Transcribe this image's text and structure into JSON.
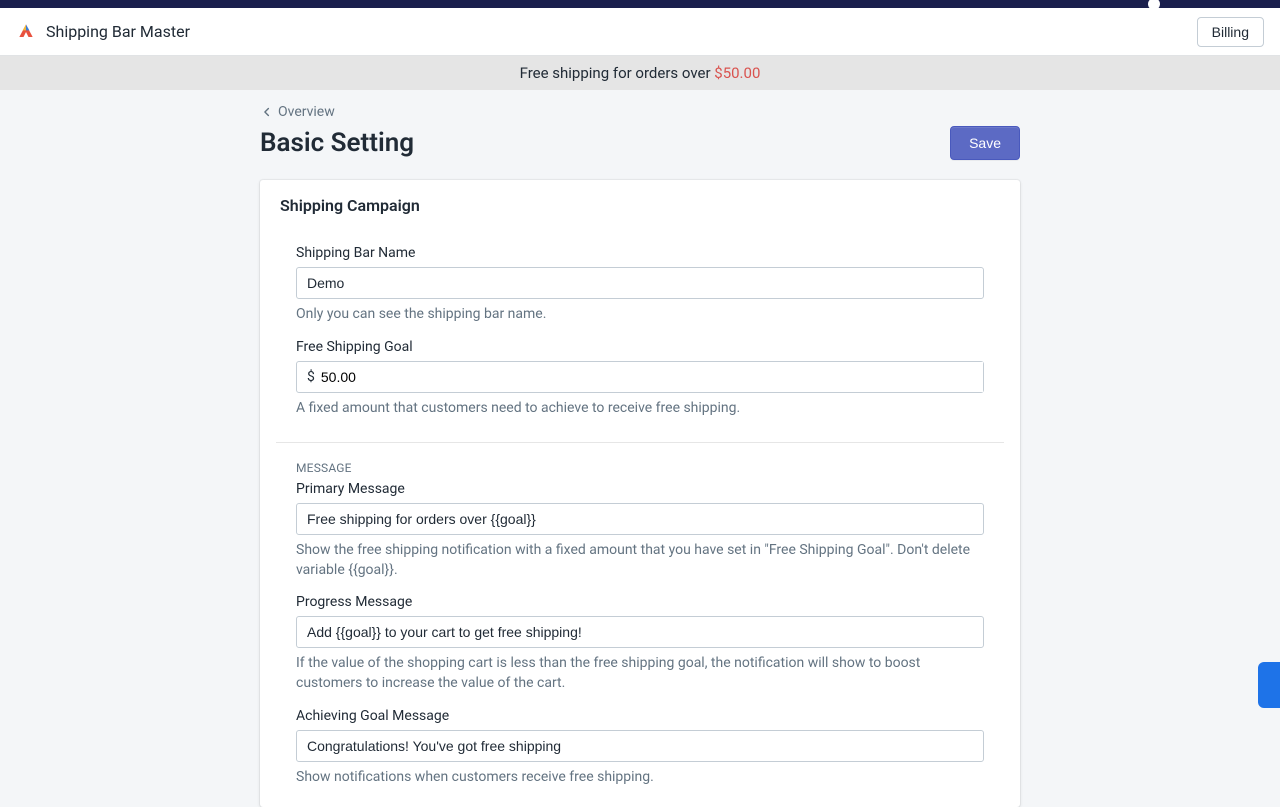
{
  "header": {
    "app_title": "Shipping Bar Master",
    "billing_label": "Billing"
  },
  "banner": {
    "text_prefix": "Free shipping for orders over ",
    "price": "$50.00"
  },
  "breadcrumb": {
    "label": "Overview"
  },
  "page": {
    "title": "Basic Setting",
    "save_label": "Save"
  },
  "card": {
    "title": "Shipping Campaign",
    "fields": {
      "name": {
        "label": "Shipping Bar Name",
        "value": "Demo",
        "help": "Only you can see the shipping bar name."
      },
      "goal": {
        "label": "Free Shipping Goal",
        "prefix": "$",
        "value": "50.00",
        "help": "A fixed amount that customers need to achieve to receive free shipping."
      }
    },
    "message_section": {
      "heading": "MESSAGE",
      "primary": {
        "label": "Primary Message",
        "value": "Free shipping for orders over {{goal}}",
        "help": "Show the free shipping notification with a fixed amount that you have set in \"Free Shipping Goal\". Don't delete variable {{goal}}."
      },
      "progress": {
        "label": "Progress Message",
        "value": "Add {{goal}} to your cart to get free shipping!",
        "help": "If the value of the shopping cart is less than the free shipping goal, the notification will show to boost customers to increase the value of the cart."
      },
      "achieving": {
        "label": "Achieving Goal Message",
        "value": "Congratulations! You've got free shipping",
        "help": "Show notifications when customers receive free shipping."
      }
    }
  }
}
